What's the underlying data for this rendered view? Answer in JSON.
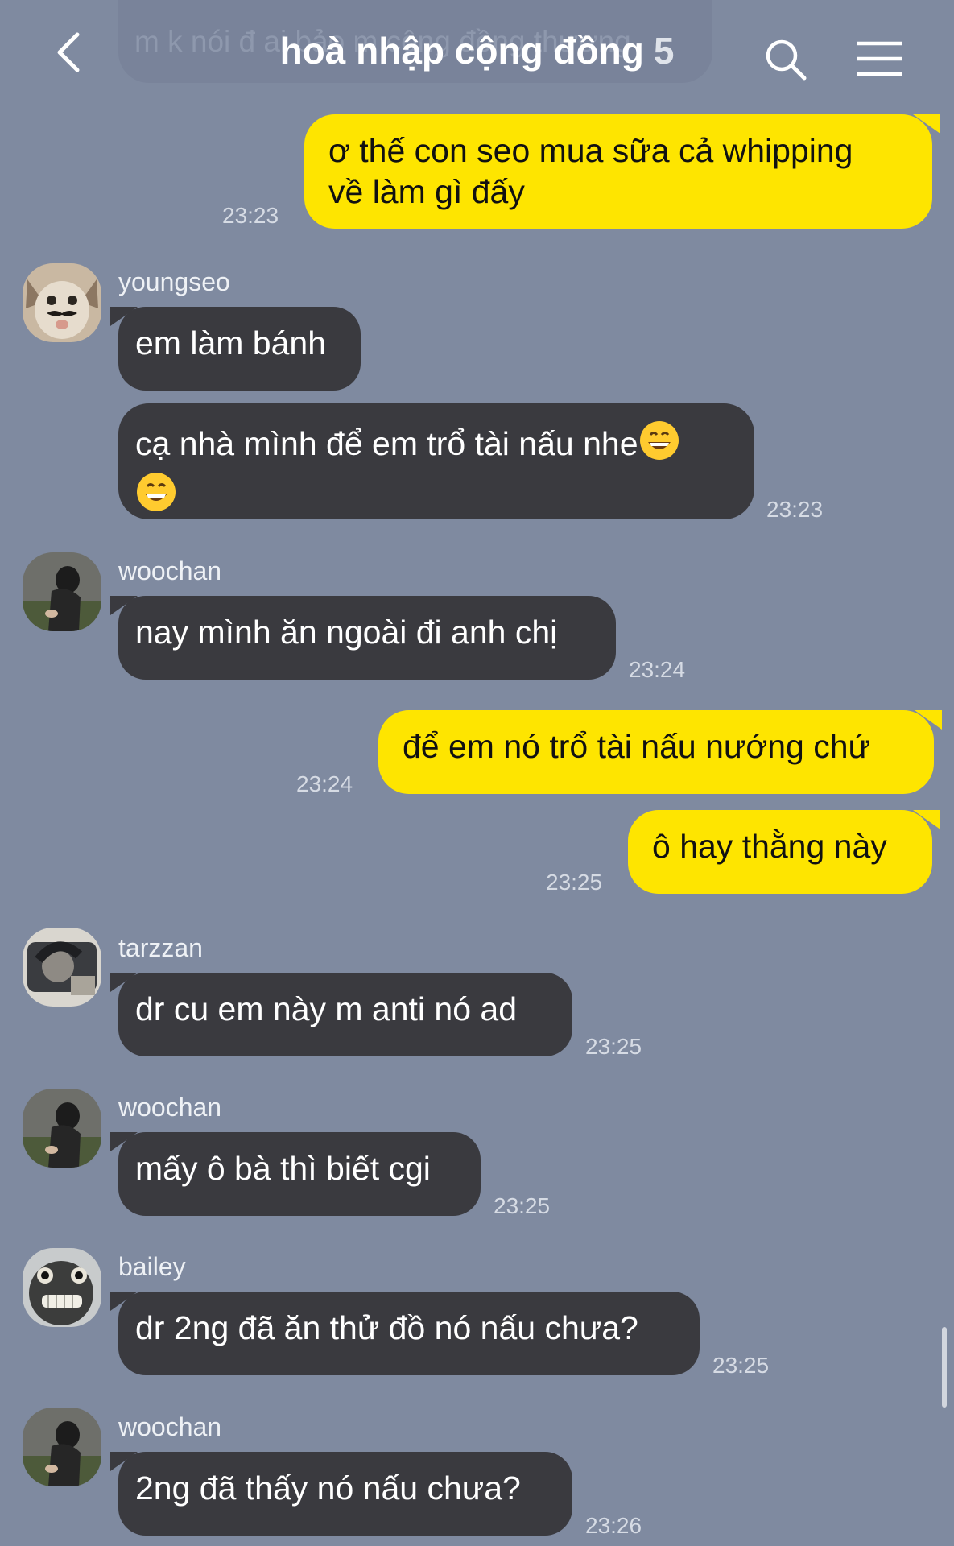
{
  "header": {
    "title": "hoà nhập cộng đồng",
    "member_count": "5",
    "pinned_preview": "m k nói đ ai bảo m cộng đồng thương"
  },
  "messages": [
    {
      "from": "me",
      "text_line1": "ơ thế con seo mua sữa cả whipping",
      "text_line2": "về làm gì đấy",
      "time": "23:23"
    },
    {
      "from": "youngseo",
      "text": "em làm bánh"
    },
    {
      "from": "youngseo",
      "text_line1": "cạ nhà mình để em trổ tài nấu nhe",
      "emoji_1": "grinning-face-emoji",
      "emoji_2": "grinning-face-emoji",
      "time": "23:23"
    },
    {
      "from": "woochan",
      "text": "nay mình ăn ngoài đi anh chị",
      "time": "23:24"
    },
    {
      "from": "me",
      "text": "để em nó trổ tài nấu nướng chứ",
      "time": "23:24"
    },
    {
      "from": "me",
      "text": "ô hay thằng này",
      "time": "23:25"
    },
    {
      "from": "tarzzan",
      "text": "dr cu em này m anti nó ad",
      "time": "23:25"
    },
    {
      "from": "woochan",
      "text": "mấy ô bà thì biết cgi",
      "time": "23:25"
    },
    {
      "from": "bailey",
      "text": "dr 2ng đã ăn thử đồ nó nấu chưa?",
      "time": "23:25"
    },
    {
      "from": "woochan",
      "text": "2ng đã thấy nó nấu chưa?",
      "time": "23:26"
    }
  ],
  "senders": {
    "youngseo": "youngseo",
    "woochan": "woochan",
    "tarzzan": "tarzzan",
    "bailey": "bailey"
  },
  "colors": {
    "background": "#7f8aa0",
    "my_bubble": "#fee500",
    "their_bubble": "#3a3a3f",
    "timestamp": "#d6dbe4"
  },
  "icons": {
    "back": "chevron-left-icon",
    "search": "search-icon",
    "menu": "hamburger-menu-icon"
  }
}
